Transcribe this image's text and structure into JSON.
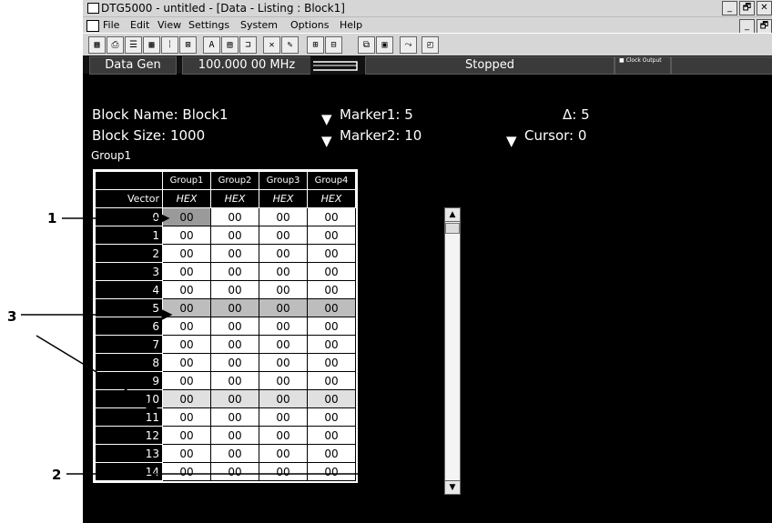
{
  "window": {
    "title": "DTG5000 - untitled - [Data - Listing : Block1]",
    "buttons": [
      "_",
      "🗗",
      "✕"
    ],
    "doc_buttons": [
      "_",
      "🗗"
    ]
  },
  "menu": [
    "File",
    "Edit",
    "View",
    "Settings",
    "System",
    "Options",
    "Help"
  ],
  "toolbar_icons": [
    "grid-icon",
    "printer-icon",
    "listing-icon",
    "pattern-icon",
    "binary-icon",
    "waveform-icon",
    "timing-icon",
    "chart-icon",
    "sequence-icon",
    "group-icon",
    "edit-icon",
    "zoom-icon",
    "copy-icon",
    "paste-icon",
    "goto-icon",
    "properties-icon"
  ],
  "status": {
    "mode": "Data Gen",
    "frequency": "100.000 00 MHz",
    "state": "Stopped",
    "clock_output": "Clock Output"
  },
  "block": {
    "name_label": "Block Name: Block1",
    "size_label": "Block Size: 1000",
    "marker1": "Marker1: 5",
    "marker2": "Marker2: 10",
    "delta": "Δ: 5",
    "cursor": "Cursor: 0",
    "group_caption": "Group1"
  },
  "table": {
    "corner": "",
    "vector_label": "Vector",
    "columns": [
      "Group1",
      "Group2",
      "Group3",
      "Group4"
    ],
    "formats": [
      "HEX",
      "HEX",
      "HEX",
      "HEX"
    ],
    "rows": [
      {
        "n": "0",
        "v": [
          "00",
          "00",
          "00",
          "00"
        ]
      },
      {
        "n": "1",
        "v": [
          "00",
          "00",
          "00",
          "00"
        ]
      },
      {
        "n": "2",
        "v": [
          "00",
          "00",
          "00",
          "00"
        ]
      },
      {
        "n": "3",
        "v": [
          "00",
          "00",
          "00",
          "00"
        ]
      },
      {
        "n": "4",
        "v": [
          "00",
          "00",
          "00",
          "00"
        ]
      },
      {
        "n": "5",
        "v": [
          "00",
          "00",
          "00",
          "00"
        ]
      },
      {
        "n": "6",
        "v": [
          "00",
          "00",
          "00",
          "00"
        ]
      },
      {
        "n": "7",
        "v": [
          "00",
          "00",
          "00",
          "00"
        ]
      },
      {
        "n": "8",
        "v": [
          "00",
          "00",
          "00",
          "00"
        ]
      },
      {
        "n": "9",
        "v": [
          "00",
          "00",
          "00",
          "00"
        ]
      },
      {
        "n": "10",
        "v": [
          "00",
          "00",
          "00",
          "00"
        ]
      },
      {
        "n": "11",
        "v": [
          "00",
          "00",
          "00",
          "00"
        ]
      },
      {
        "n": "12",
        "v": [
          "00",
          "00",
          "00",
          "00"
        ]
      },
      {
        "n": "13",
        "v": [
          "00",
          "00",
          "00",
          "00"
        ]
      },
      {
        "n": "14",
        "v": [
          "00",
          "00",
          "00",
          "00"
        ]
      }
    ]
  },
  "callouts": [
    "1",
    "3",
    "2"
  ]
}
